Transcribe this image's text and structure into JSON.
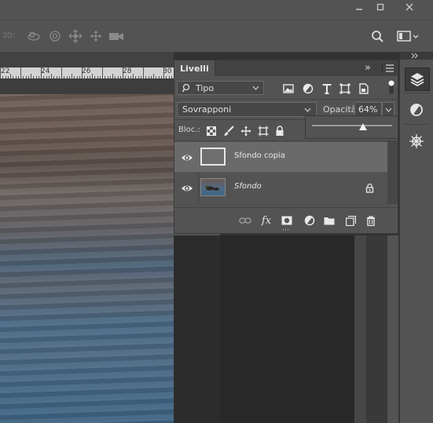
{
  "window": {
    "minimize": "minimize",
    "maximize": "maximize",
    "close": "close"
  },
  "options_bar": {
    "mode_3d_label": "3D:",
    "icons": [
      "orbit-3d-icon",
      "roll-3d-icon",
      "pan-3d-icon",
      "slide-3d-icon",
      "camera-3d-icon"
    ]
  },
  "ruler": {
    "labels": [
      "22",
      "24",
      "26",
      "28",
      "30"
    ]
  },
  "layers_panel": {
    "tab_label": "Livelli",
    "collapse_glyph": "»",
    "filter": {
      "selected": "Tipo",
      "icons": [
        "pixel-filter-icon",
        "adjustment-filter-icon",
        "type-filter-icon",
        "shape-filter-icon",
        "smartobject-filter-icon"
      ]
    },
    "blend_mode": "Sovrapponi",
    "opacity_label": "Opacità:",
    "opacity_value": "64%",
    "opacity_fraction": 0.64,
    "lock_label": "Bloc.:",
    "layers": [
      {
        "name": "Sfondo copia",
        "selected": true,
        "locked": false,
        "italic": false
      },
      {
        "name": "Sfondo",
        "selected": false,
        "locked": true,
        "italic": true
      }
    ],
    "bottom_icons": [
      "link-icon",
      "fx-icon",
      "mask-icon",
      "adjustment-layer-icon",
      "group-folder-icon",
      "new-layer-icon",
      "trash-icon"
    ],
    "fx_label": "fx"
  },
  "colors": {
    "panel_bg": "#535353",
    "selected_row": "#6a6a6a",
    "app_bg": "#323232"
  }
}
